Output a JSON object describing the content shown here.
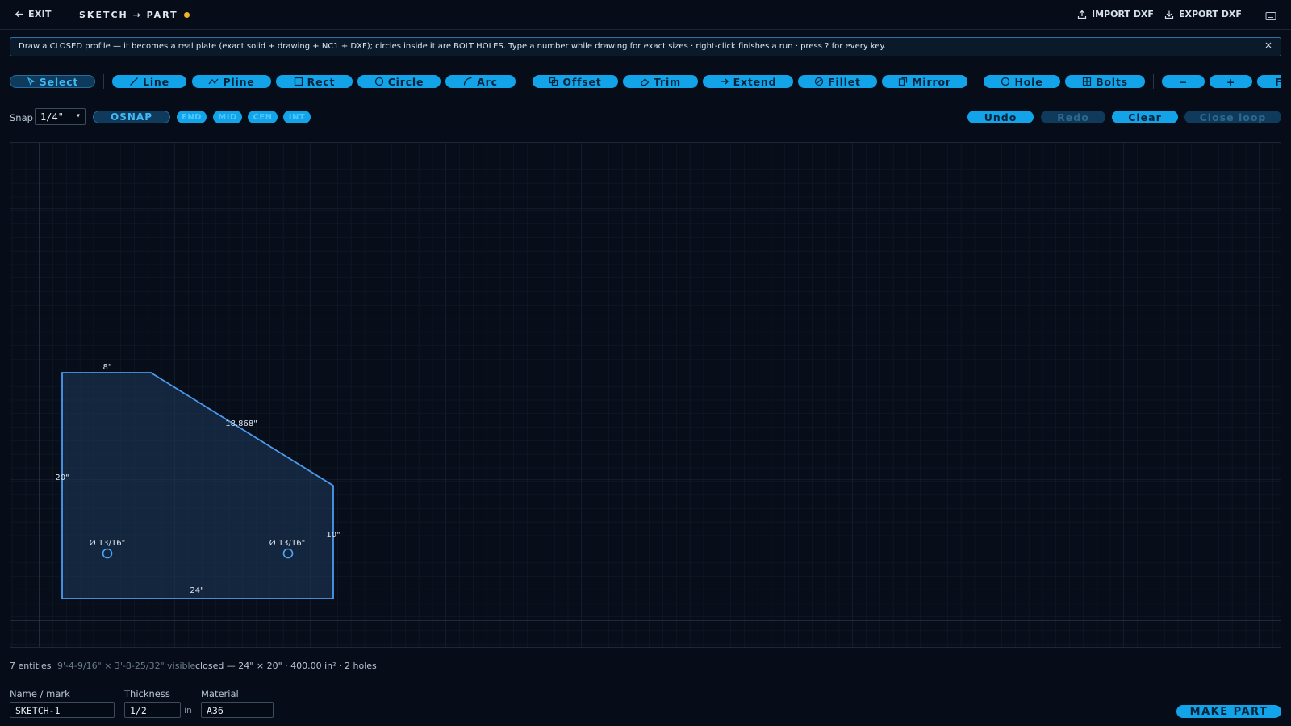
{
  "header": {
    "exit_label": "EXIT",
    "title": "SKETCH → PART",
    "import_label": "IMPORT DXF",
    "export_label": "EXPORT DXF"
  },
  "banner": {
    "text": "Draw a CLOSED profile — it becomes a real plate (exact solid + drawing + NC1 + DXF); circles inside it are BOLT HOLES. Type a number while drawing for exact sizes · right-click finishes a run · press ? for every key."
  },
  "toolbar": {
    "select": "Select",
    "line": "Line",
    "pline": "Pline",
    "rect": "Rect",
    "circle": "Circle",
    "arc": "Arc",
    "offset": "Offset",
    "trim": "Trim",
    "extend": "Extend",
    "fillet": "Fillet",
    "mirror": "Mirror",
    "hole": "Hole",
    "bolts": "Bolts",
    "zoom_out": "−",
    "zoom_in": "+",
    "fit": "F"
  },
  "snap": {
    "label": "Snap",
    "value": "1/4\"",
    "osnap": "OSNAP",
    "chips": [
      "END",
      "MID",
      "CEN",
      "INT"
    ]
  },
  "actions": {
    "undo": "Undo",
    "redo": "Redo",
    "clear": "Clear",
    "close_loop": "Close loop"
  },
  "sketch": {
    "dims": {
      "top": "8\"",
      "diagonal": "18.868\"",
      "left": "20\"",
      "right": "10\"",
      "bottom": "24\"",
      "hole1": "Ø 13/16\"",
      "hole2": "Ø 13/16\""
    }
  },
  "status": {
    "entities": "7 entities",
    "visible": "9'-4-9/16\" × 3'-8-25/32\" visible",
    "summary": "closed — 24\" × 20\" · 400.00 in² · 2 holes"
  },
  "form": {
    "name_label": "Name / mark",
    "name_value": "SKETCH-1",
    "thickness_label": "Thickness",
    "thickness_value": "1/2",
    "thickness_unit": "in",
    "material_label": "Material",
    "material_value": "A36",
    "make_part": "MAKE PART"
  },
  "colors": {
    "accent": "#12a3e8",
    "profile": "#4a9bf0",
    "dirty": "#f0b429"
  }
}
